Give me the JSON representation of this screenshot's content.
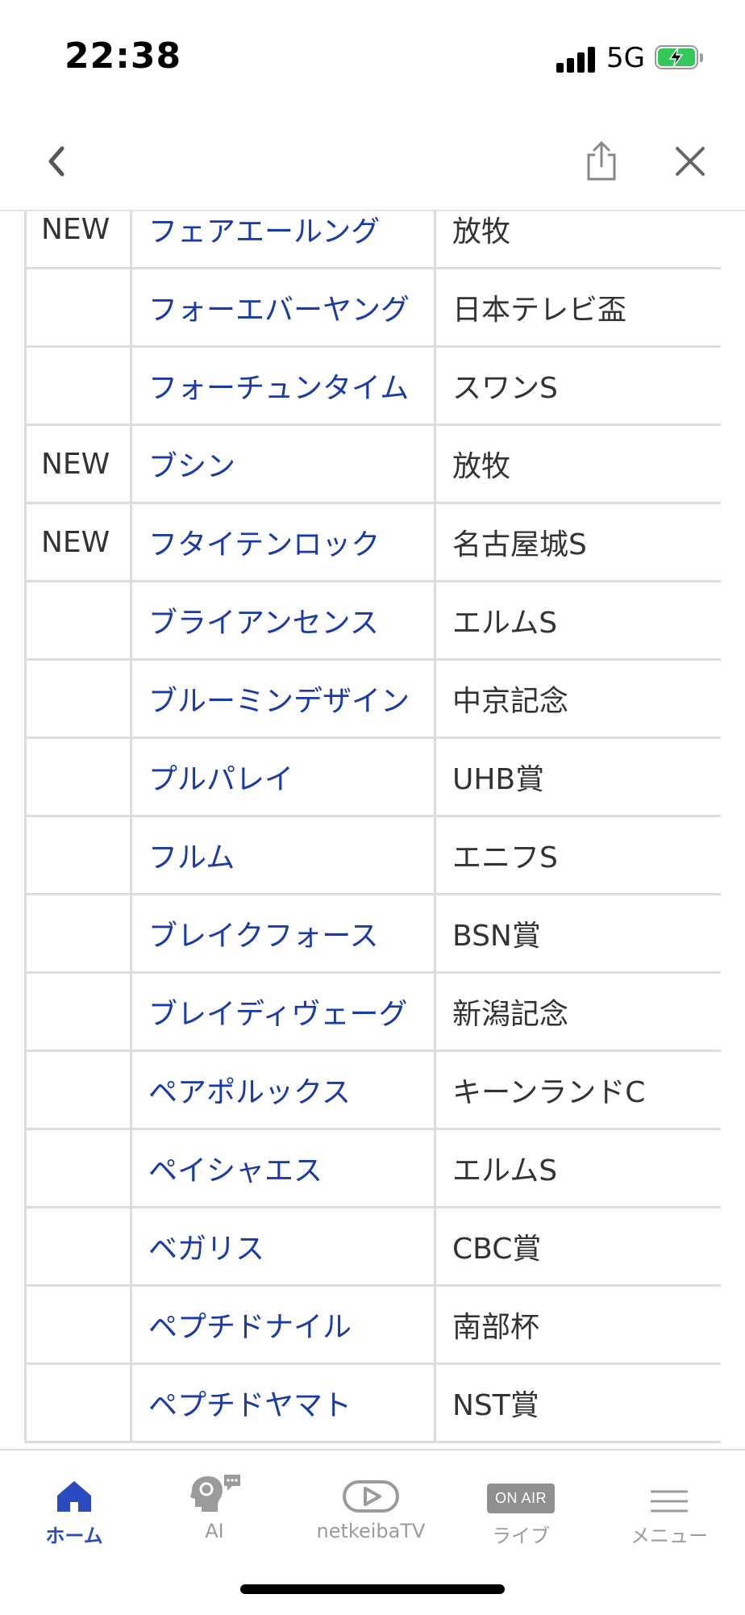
{
  "status_bar": {
    "time": "22:38",
    "network": "5G",
    "battery": "charging"
  },
  "nav": {
    "back_icon": "chevron-left-icon",
    "share_icon": "share-icon",
    "close_icon": "close-icon"
  },
  "rows": [
    {
      "badge": "NEW",
      "horse": "フェアエールング",
      "race": "放牧"
    },
    {
      "badge": "",
      "horse": "フォーエバーヤング",
      "race": "日本テレビ盃"
    },
    {
      "badge": "",
      "horse": "フォーチュンタイム",
      "race": "スワンS"
    },
    {
      "badge": "NEW",
      "horse": "ブシン",
      "race": "放牧"
    },
    {
      "badge": "NEW",
      "horse": "フタイテンロック",
      "race": "名古屋城S"
    },
    {
      "badge": "",
      "horse": "ブライアンセンス",
      "race": "エルムS"
    },
    {
      "badge": "",
      "horse": "ブルーミンデザイン",
      "race": "中京記念"
    },
    {
      "badge": "",
      "horse": "プルパレイ",
      "race": "UHB賞"
    },
    {
      "badge": "",
      "horse": "フルム",
      "race": "エニフS"
    },
    {
      "badge": "",
      "horse": "ブレイクフォース",
      "race": "BSN賞"
    },
    {
      "badge": "",
      "horse": "ブレイディヴェーグ",
      "race": "新潟記念"
    },
    {
      "badge": "",
      "horse": "ペアポルックス",
      "race": "キーンランドC"
    },
    {
      "badge": "",
      "horse": "ペイシャエス",
      "race": "エルムS"
    },
    {
      "badge": "",
      "horse": "ベガリス",
      "race": "CBC賞"
    },
    {
      "badge": "",
      "horse": "ペプチドナイル",
      "race": "南部杯"
    },
    {
      "badge": "",
      "horse": "ペプチドヤマト",
      "race": "NST賞"
    }
  ],
  "tabs": [
    {
      "label": "ホーム",
      "icon": "home-icon",
      "active": true
    },
    {
      "label": "AI",
      "icon": "ai-brain-icon",
      "active": false
    },
    {
      "label": "netkeibaTV",
      "icon": "play-tv-icon",
      "active": false
    },
    {
      "label": "ライブ",
      "icon": "on-air-icon",
      "badge": "ON AIR",
      "active": false
    },
    {
      "label": "メニュー",
      "icon": "menu-icon",
      "active": false
    }
  ],
  "colors": {
    "link": "#1a3aa8",
    "active_tab": "#2a4cc0",
    "inactive": "#9b9b9b",
    "border": "#dcdcdc"
  }
}
